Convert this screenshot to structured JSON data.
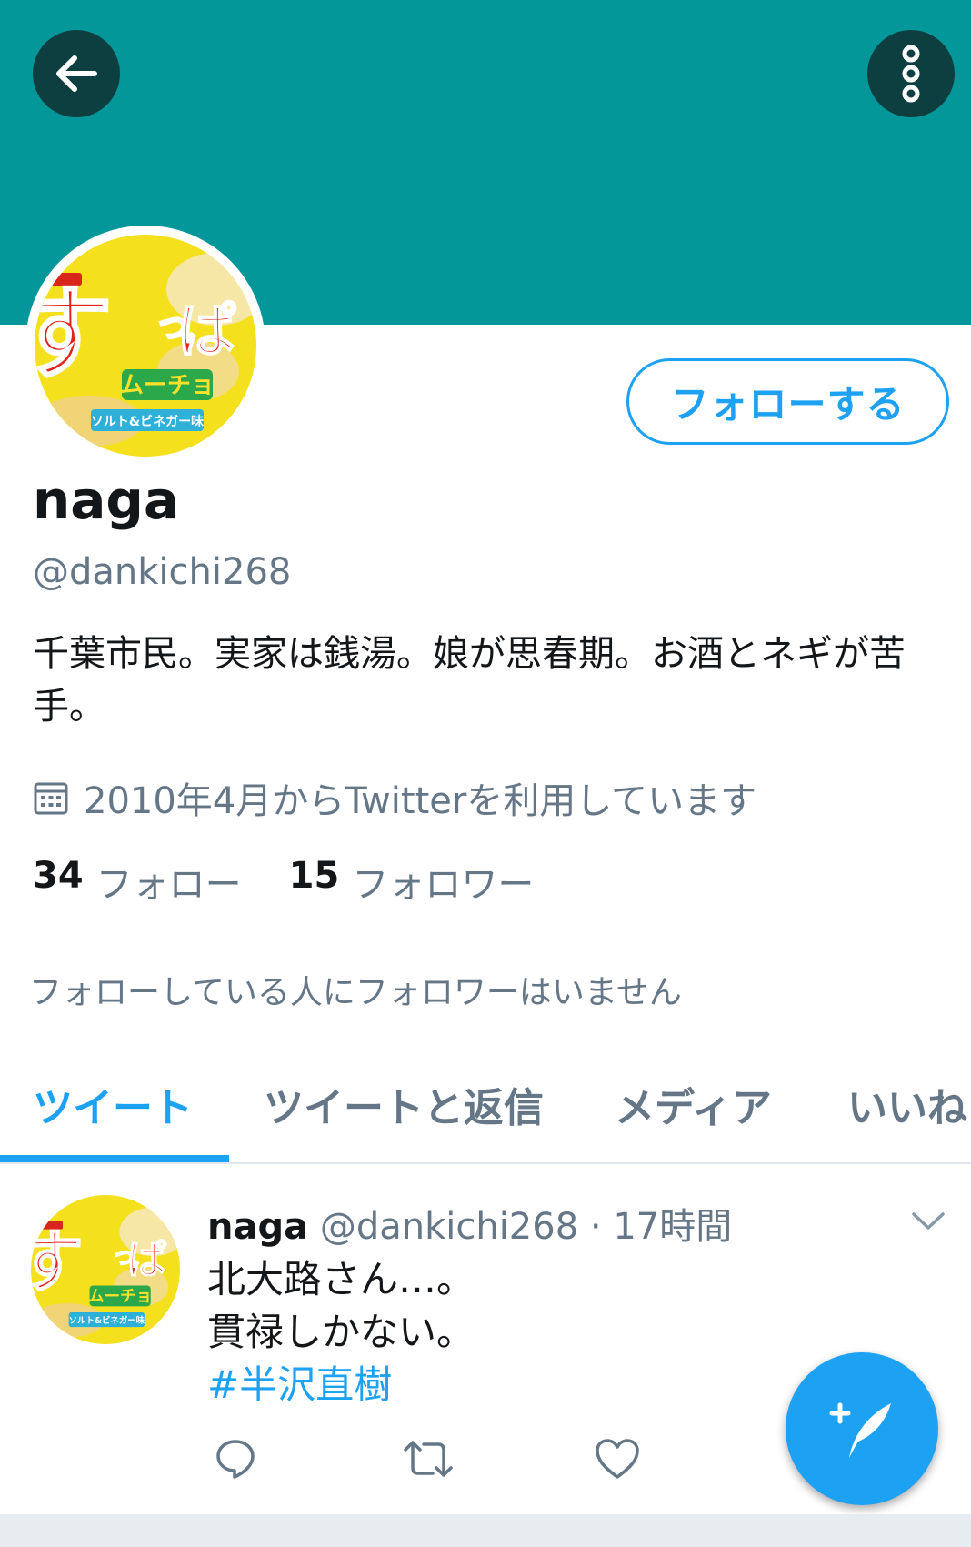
{
  "profile": {
    "name": "naga",
    "handle": "@dankichi268",
    "bio": "千葉市民。実家は銭湯。娘が思春期。お酒とネギが苦手。",
    "joined": "2010年4月からTwitterを利用しています",
    "follow_button": "フォローする",
    "following_count": "34",
    "following_label": "フォロー",
    "followers_count": "15",
    "followers_label": "フォロワー",
    "known_followers": "フォローしている人にフォロワーはいません",
    "avatar_logo_text": "すっぱムーチョ"
  },
  "tabs": [
    {
      "label": "ツイート",
      "active": true
    },
    {
      "label": "ツイートと返信",
      "active": false
    },
    {
      "label": "メディア",
      "active": false
    },
    {
      "label": "いいね",
      "active": false
    }
  ],
  "tweet": {
    "name": "naga",
    "handle": "@dankichi268",
    "separator": "·",
    "time": "17時間",
    "line1": "北大路さん…。",
    "line2": "貫禄しかない。",
    "hashtag": "#半沢直樹"
  },
  "icons": {
    "back": "arrow-left-icon",
    "more": "more-vertical-icon",
    "calendar": "calendar-icon",
    "chevron": "chevron-down-icon",
    "reply": "reply-icon",
    "retweet": "retweet-icon",
    "like": "heart-icon",
    "compose": "compose-tweet-icon"
  },
  "colors": {
    "banner": "#03979a",
    "accent": "#1da1f2",
    "secondary_text": "#657786"
  }
}
